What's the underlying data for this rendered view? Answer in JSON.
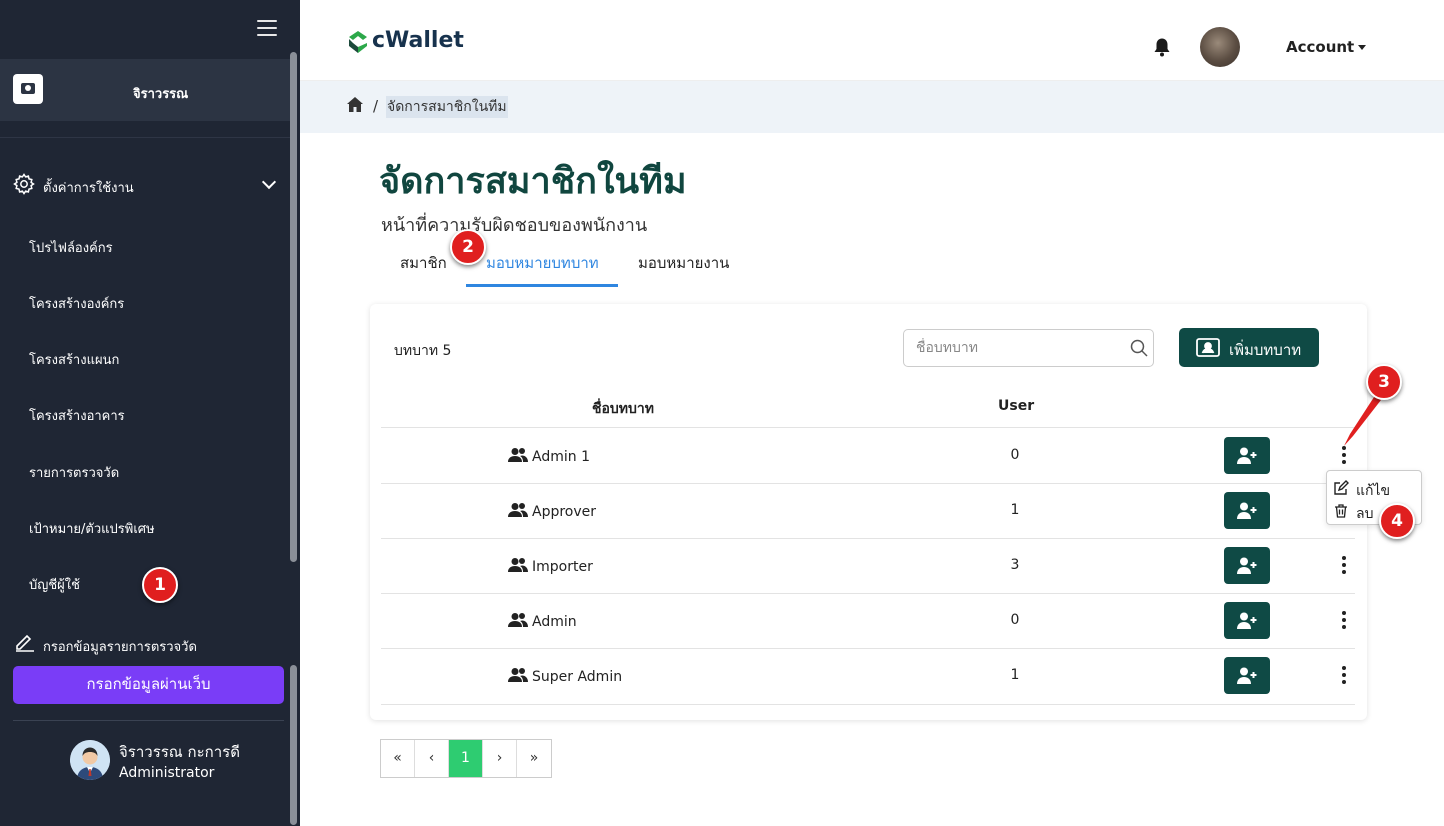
{
  "sidebar": {
    "org_name": "จิราวรรณ",
    "settings_label": "ตั้งค่าการใช้งาน",
    "items": [
      {
        "label": "โปรไฟล์องค์กร"
      },
      {
        "label": "โครงสร้างองค์กร"
      },
      {
        "label": "โครงสร้างแผนก"
      },
      {
        "label": "โครงสร้างอาคาร"
      },
      {
        "label": "รายการตรวจวัด"
      },
      {
        "label": "เป้าหมาย/ตัวแปรพิเศษ"
      },
      {
        "label": "บัญชีผู้ใช้"
      }
    ],
    "fill_label": "กรอกข้อมูลรายการตรวจวัด",
    "web_button": "กรอกข้อมูลผ่านเว็บ",
    "user": {
      "name": "จิราวรรณ กะการดี",
      "role": "Administrator"
    }
  },
  "header": {
    "logo_text": "cWallet",
    "account_label": "Account"
  },
  "breadcrumb": {
    "separator": "/",
    "current": "จัดการสมาชิกในทีม"
  },
  "page": {
    "title": "จัดการสมาชิกในทีม",
    "subtitle": "หน้าที่ความรับผิดชอบของพนักงาน",
    "tabs": [
      {
        "label": "สมาชิก"
      },
      {
        "label": "มอบหมายบทบาท"
      },
      {
        "label": "มอบหมายงาน"
      }
    ]
  },
  "roles": {
    "count_label": "บทบาท 5",
    "search_placeholder": "ชื่อบทบาท",
    "add_button": "เพิ่มบทบาท",
    "columns": {
      "name": "ชื่อบทบาท",
      "user": "User"
    },
    "rows": [
      {
        "name": "Admin 1",
        "users": "0"
      },
      {
        "name": "Approver",
        "users": "1"
      },
      {
        "name": "Importer",
        "users": "3"
      },
      {
        "name": "Admin",
        "users": "0"
      },
      {
        "name": "Super Admin",
        "users": "1"
      }
    ]
  },
  "dropdown": {
    "edit": "แก้ไข",
    "delete": "ลบ"
  },
  "pagination": {
    "first": "«",
    "prev": "‹",
    "current": "1",
    "next": "›",
    "last": "»"
  },
  "annotations": {
    "b1": "1",
    "b2": "2",
    "b3": "3",
    "b4": "4"
  },
  "colors": {
    "sidebar": "#1f2634",
    "primary": "#0f4a45",
    "accent_purple": "#7a3df7",
    "tab_active": "#2f86e0",
    "badge": "#e01f1f",
    "page_active": "#2ecc71"
  }
}
